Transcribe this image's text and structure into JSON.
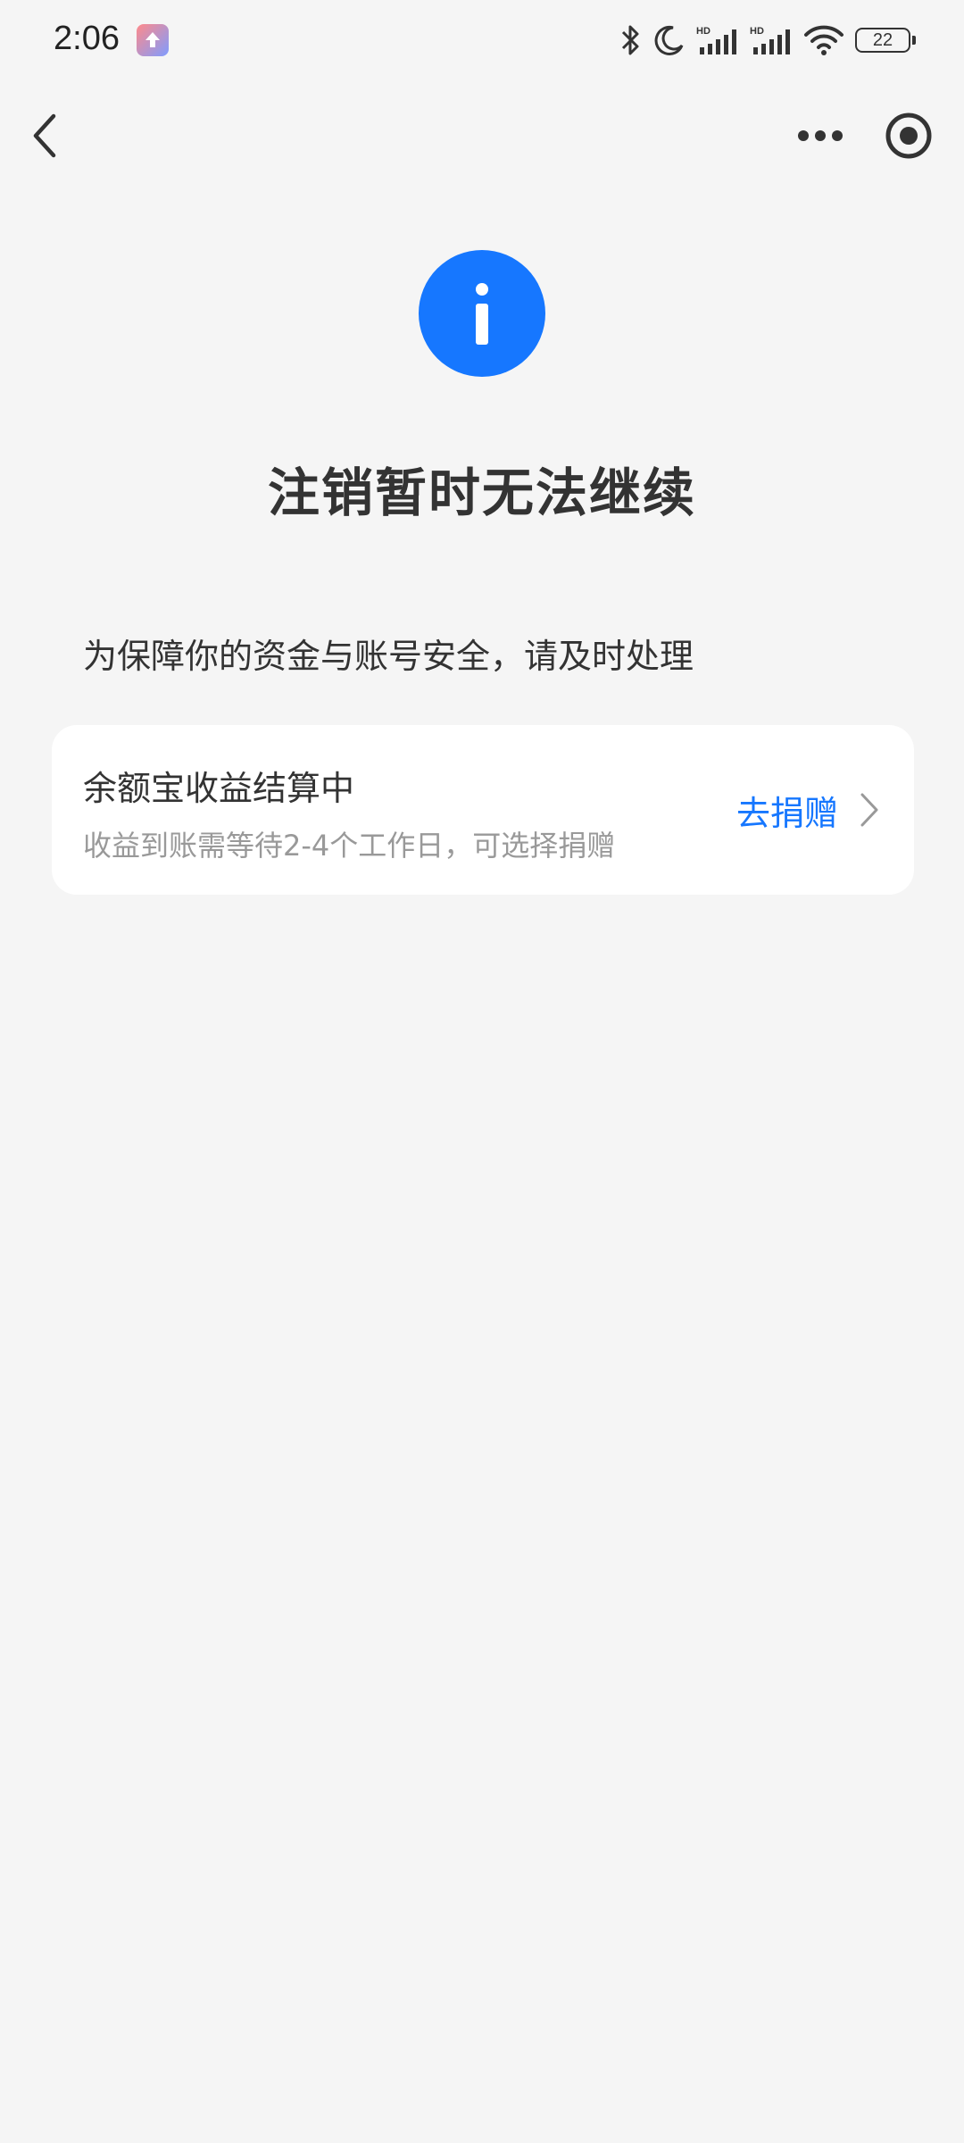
{
  "status_bar": {
    "time": "2:06",
    "battery": "22",
    "icons": [
      "app-notification-icon",
      "bluetooth-icon",
      "moon-icon",
      "hd-signal-icon",
      "hd-signal-icon",
      "wifi-icon",
      "battery-icon"
    ]
  },
  "nav": {
    "icons": [
      "back-icon",
      "more-icon",
      "close-mini-program-icon"
    ]
  },
  "main": {
    "icon": "info-icon",
    "accent_color": "#1677ff",
    "title": "注销暂时无法继续",
    "subtitle": "为保障你的资金与账号安全，请及时处理"
  },
  "card": {
    "title": "余额宝收益结算中",
    "description": "收益到账需等待2-4个工作日，可选择捐赠",
    "action_label": "去捐赠"
  }
}
